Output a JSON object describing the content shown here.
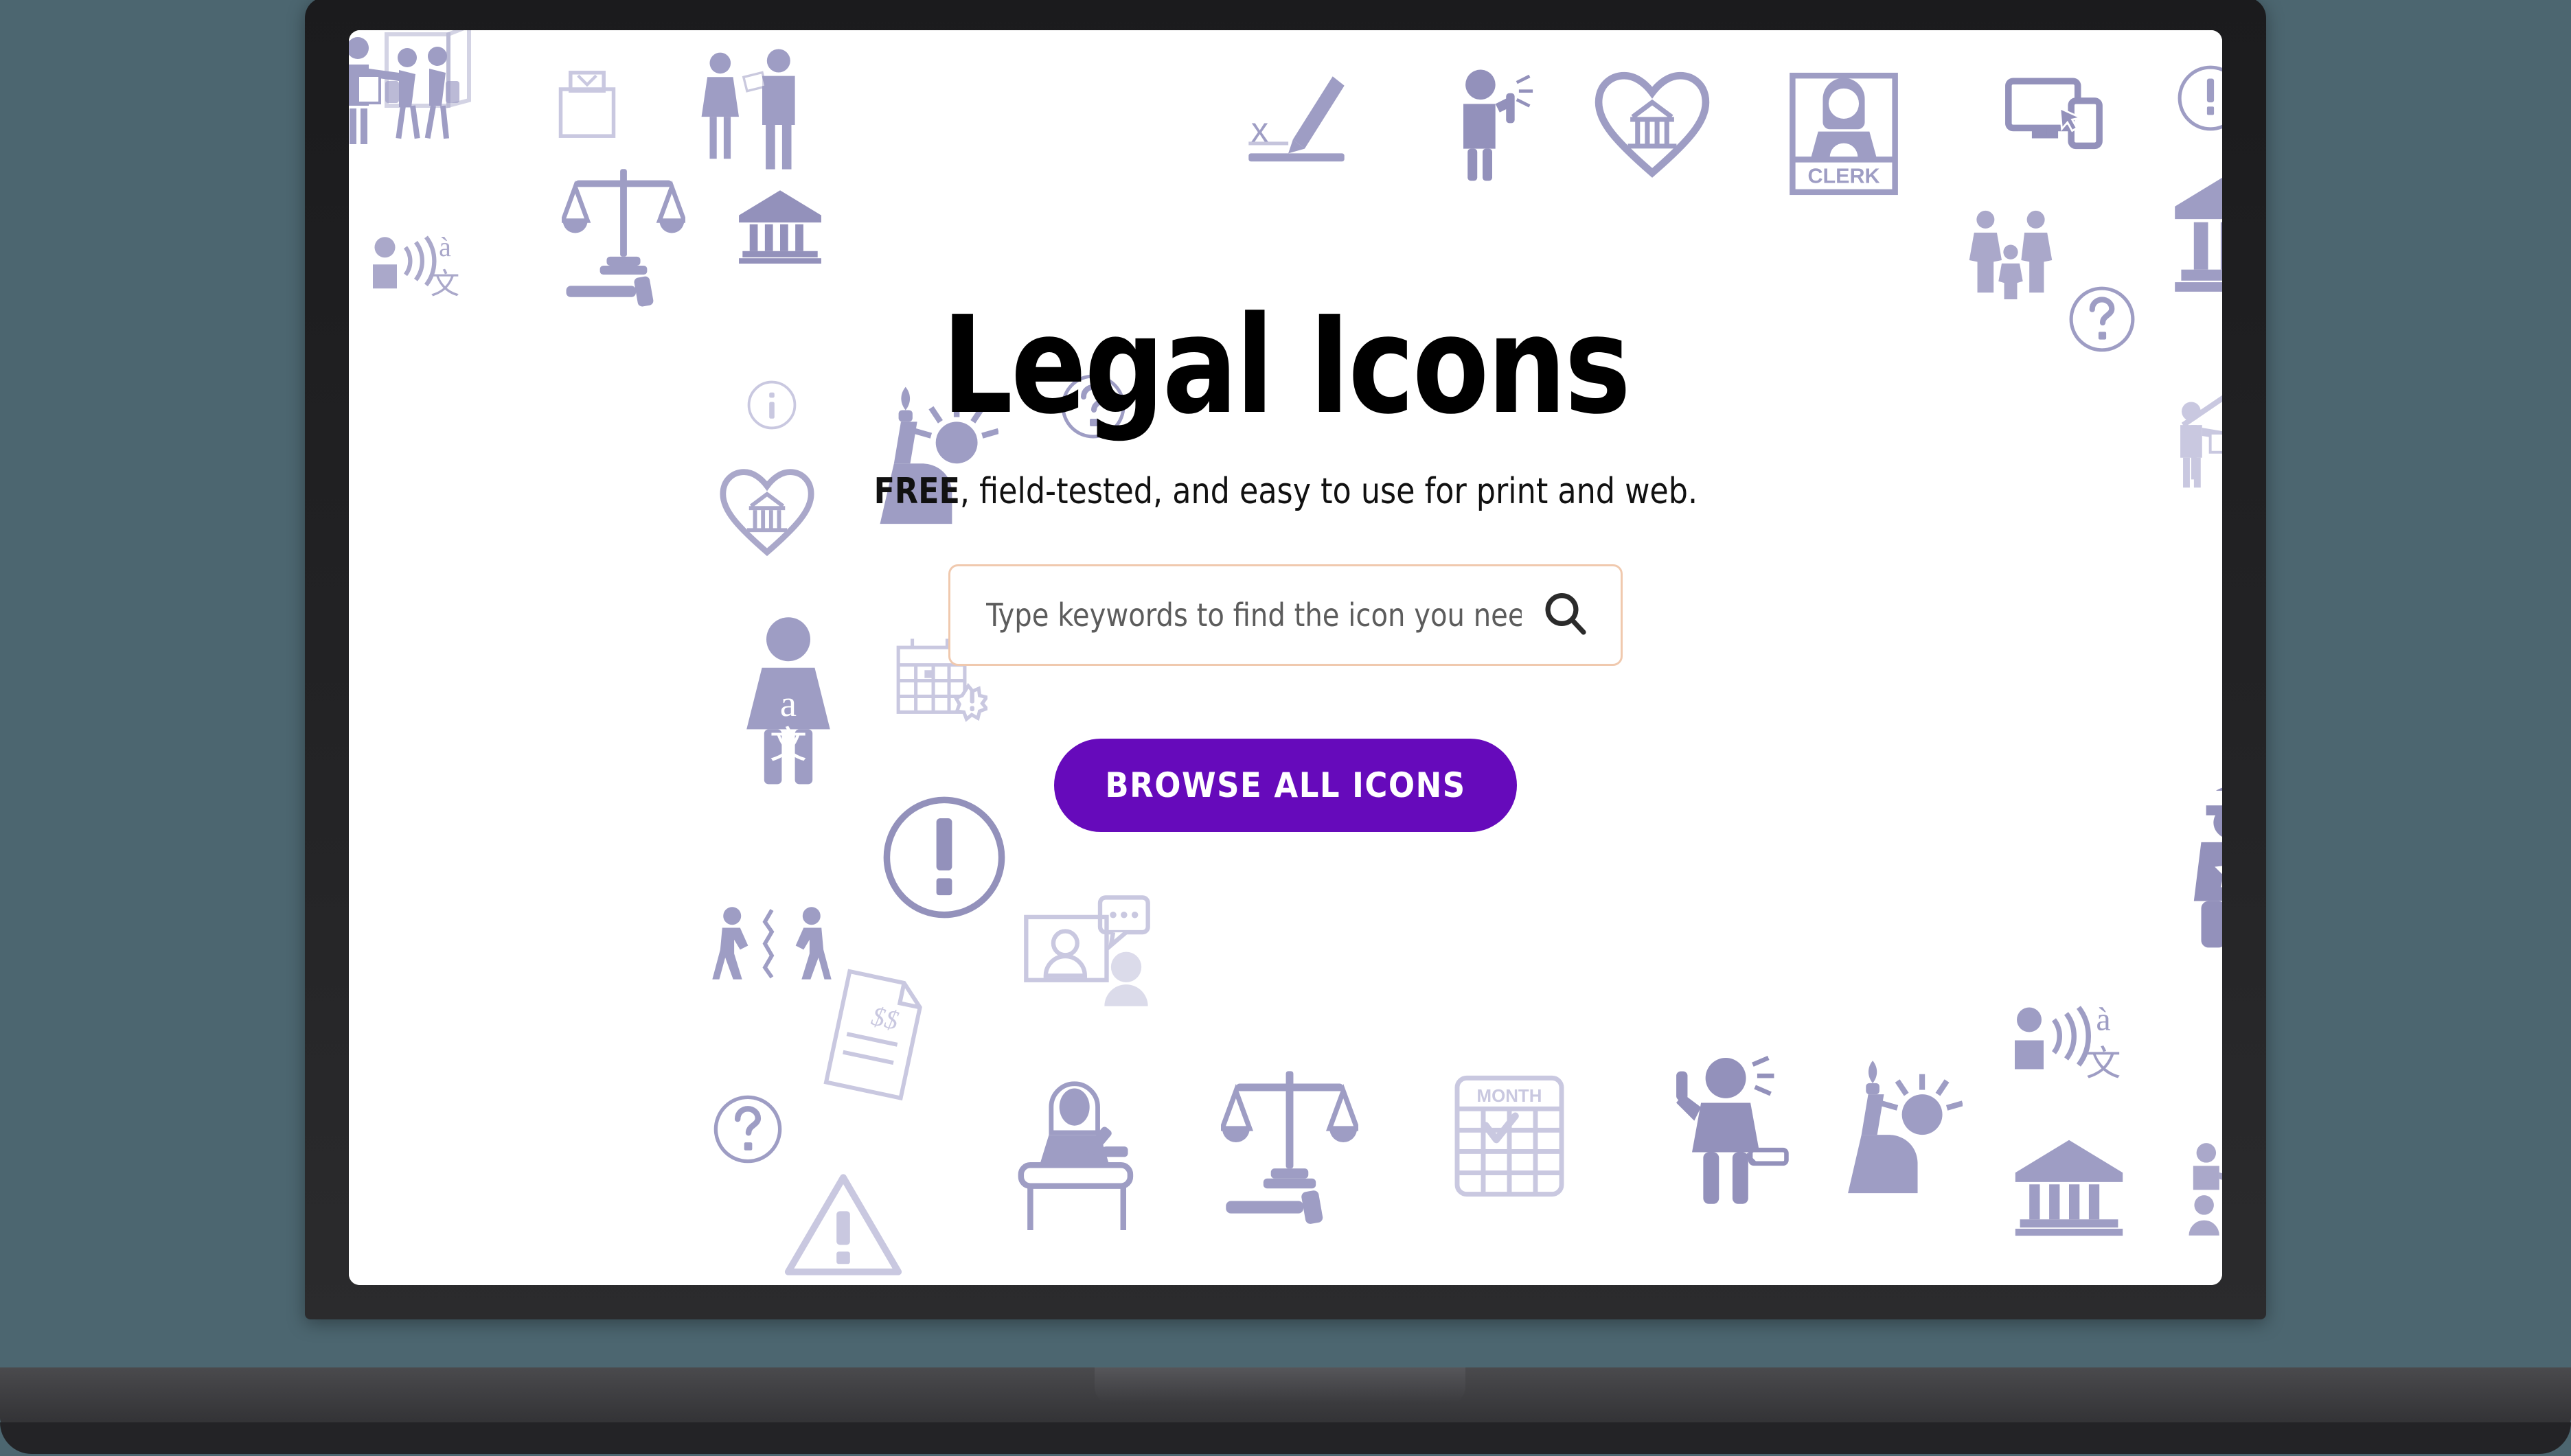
{
  "device": {
    "type": "laptop-mockup",
    "backdrop_color": "#4C6670",
    "bezel_color": "#222224"
  },
  "page": {
    "title": "Legal Icons",
    "subtitle_bold": "FREE",
    "subtitle_rest": ", field-tested, and easy to use for print and web.",
    "background_color": "#FFFFFF"
  },
  "search": {
    "placeholder": "Type keywords to find the icon you need",
    "value": "",
    "border_color": "#F0C9AE",
    "icon": "magnifier-icon"
  },
  "cta": {
    "label": "BROWSE ALL ICONS",
    "background_color": "#660ABB",
    "text_color": "#FFFFFF"
  },
  "icon_wallpaper": {
    "tint_color": "#9E9DC4",
    "pale_tint_color": "#C9C8E0",
    "labels": {
      "clerk": "CLERK",
      "month": "MONTH",
      "signature_x": "x",
      "money_doc": "$$"
    },
    "items": [
      "eviction-notice-icon",
      "ballot-box-icon",
      "two-people-document-icon",
      "signature-icon",
      "person-speaking-icon",
      "heart-courthouse-icon",
      "clerk-sign-icon",
      "devices-icon",
      "exclamation-circle-icon",
      "eviction-notice-icon",
      "interpreter-icon",
      "scales-gavel-icon",
      "courthouse-icon",
      "family-group-icon",
      "question-circle-icon",
      "courthouse-large-icon",
      "no-food-drink-icon",
      "info-circle-icon",
      "statue-of-liberty-icon",
      "question-circle-icon",
      "heart-courthouse-icon",
      "house-eviction-icon",
      "person-standing-icon",
      "translator-woman-icon",
      "calendar-alert-icon",
      "info-circle-icon",
      "dollar-down-arrow-icon",
      "exclamation-circle-icon",
      "conflict-people-icon",
      "video-call-icon",
      "police-officer-icon",
      "family-walking-icon",
      "money-document-icon",
      "question-circle-icon",
      "warning-triangle-icon",
      "judge-bench-icon",
      "scales-gavel-icon",
      "calendar-month-icon",
      "oath-person-icon",
      "statue-of-liberty-icon",
      "interpreter-icon",
      "hearing-ear-icon",
      "scales-gavel-icon",
      "courthouse-icon",
      "presentation-icon",
      "judge-bench-icon"
    ]
  }
}
